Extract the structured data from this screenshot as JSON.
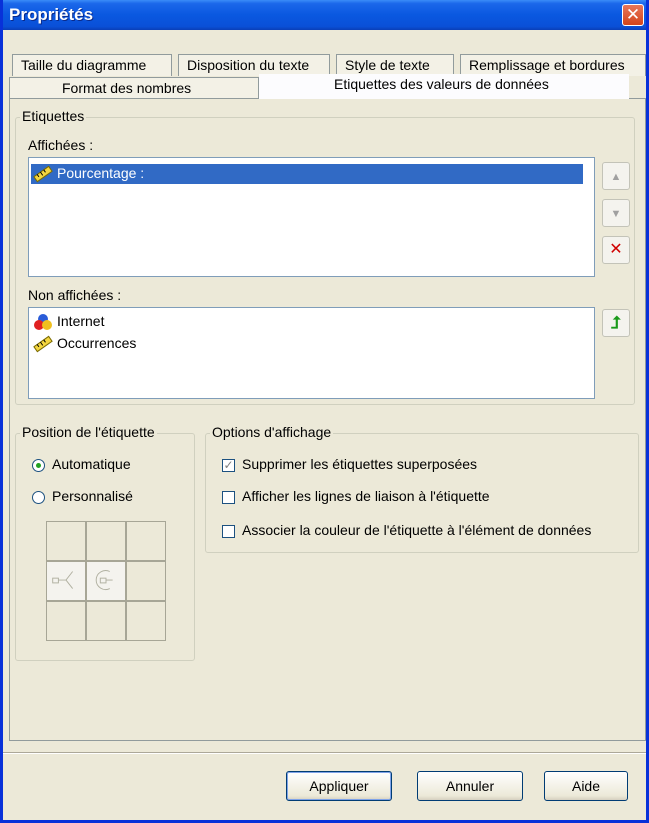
{
  "window": {
    "title": "Propriétés",
    "close_glyph": "✕"
  },
  "tabs_row1": [
    "Taille du diagramme",
    "Disposition du texte",
    "Style de texte",
    "Remplissage et bordures"
  ],
  "tabs_row2": [
    "Format des nombres",
    "Etiquettes des valeurs de données"
  ],
  "labels_group": {
    "title": "Etiquettes",
    "shown_label": "Affichées :",
    "shown_items": [
      {
        "label": "Pourcentage :",
        "icon": "ruler-icon",
        "selected": true
      }
    ],
    "hidden_label": "Non affichées :",
    "hidden_items": [
      {
        "label": "Internet",
        "icon": "colors-icon"
      },
      {
        "label": "Occurrences",
        "icon": "ruler-icon"
      }
    ],
    "buttons": {
      "up": "▲",
      "down": "▼",
      "remove": "✕",
      "add": "⮥"
    }
  },
  "position_group": {
    "title": "Position de l'étiquette",
    "options": [
      {
        "label": "Automatique",
        "checked": true
      },
      {
        "label": "Personnalisé",
        "checked": false
      }
    ]
  },
  "display_group": {
    "title": "Options d'affichage",
    "options": [
      {
        "label": "Supprimer les étiquettes superposées",
        "checked": true
      },
      {
        "label": "Afficher les lignes de liaison à l'étiquette",
        "checked": false
      },
      {
        "label": "Associer la couleur de l'étiquette à l'élément de données",
        "checked": false
      }
    ]
  },
  "footer": {
    "apply": "Appliquer",
    "cancel": "Annuler",
    "help": "Aide"
  },
  "colors": {
    "title_bar": "#0a58e0",
    "selection": "#316ac5",
    "remove_red": "#d00000",
    "add_green": "#1a9a1a"
  }
}
